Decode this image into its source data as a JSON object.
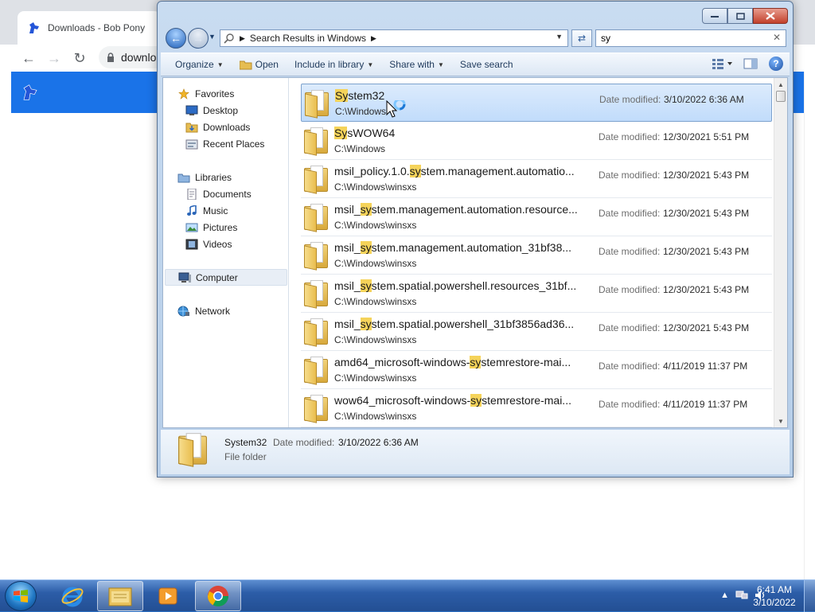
{
  "browser": {
    "tab_title": "Downloads - Bob Pony",
    "url_partial": "downlo",
    "icons": {
      "back": "arrow-left-icon",
      "forward": "arrow-right-icon",
      "reload": "reload-icon",
      "lock": "lock-icon",
      "favicon": "pony-icon"
    }
  },
  "explorer": {
    "address": "Search Results in Windows",
    "search_value": "sy",
    "toolbar": {
      "organize": "Organize",
      "open": "Open",
      "include_in_library": "Include in library",
      "share_with": "Share with",
      "save_search": "Save search"
    },
    "nav": {
      "favorites": "Favorites",
      "desktop": "Desktop",
      "downloads": "Downloads",
      "recent_places": "Recent Places",
      "libraries": "Libraries",
      "documents": "Documents",
      "music": "Music",
      "pictures": "Pictures",
      "videos": "Videos",
      "computer": "Computer",
      "network": "Network"
    },
    "date_label": "Date modified:",
    "results": [
      {
        "pre": "",
        "hl": "Sy",
        "post": "stem32",
        "path": "C:\\Windows",
        "date": "3/10/2022 6:36 AM",
        "selected": true
      },
      {
        "pre": "",
        "hl": "Sy",
        "post": "sWOW64",
        "path": "C:\\Windows",
        "date": "12/30/2021 5:51 PM"
      },
      {
        "pre": "msil_policy.1.0.",
        "hl": "sy",
        "post": "stem.management.automatio...",
        "path": "C:\\Windows\\winsxs",
        "date": "12/30/2021 5:43 PM"
      },
      {
        "pre": "msil_",
        "hl": "sy",
        "post": "stem.management.automation.resource...",
        "path": "C:\\Windows\\winsxs",
        "date": "12/30/2021 5:43 PM"
      },
      {
        "pre": "msil_",
        "hl": "sy",
        "post": "stem.management.automation_31bf38...",
        "path": "C:\\Windows\\winsxs",
        "date": "12/30/2021 5:43 PM"
      },
      {
        "pre": "msil_",
        "hl": "sy",
        "post": "stem.spatial.powershell.resources_31bf...",
        "path": "C:\\Windows\\winsxs",
        "date": "12/30/2021 5:43 PM"
      },
      {
        "pre": "msil_",
        "hl": "sy",
        "post": "stem.spatial.powershell_31bf3856ad36...",
        "path": "C:\\Windows\\winsxs",
        "date": "12/30/2021 5:43 PM"
      },
      {
        "pre": "amd64_microsoft-windows-",
        "hl": "sy",
        "post": "stemrestore-mai...",
        "path": "C:\\Windows\\winsxs",
        "date": "4/11/2019 11:37 PM"
      },
      {
        "pre": "wow64_microsoft-windows-",
        "hl": "sy",
        "post": "stemrestore-mai...",
        "path": "C:\\Windows\\winsxs",
        "date": "4/11/2019 11:37 PM"
      }
    ],
    "details": {
      "name": "System32",
      "date_label": "Date modified:",
      "date": "3/10/2022 6:36 AM",
      "type": "File folder"
    }
  },
  "taskbar": {
    "time": "6:41 AM",
    "date": "3/10/2022",
    "pinned": [
      "internet-explorer-icon",
      "windows-explorer-icon",
      "media-player-icon",
      "chrome-icon"
    ]
  },
  "colors": {
    "highlight": "#f5d35a",
    "selection": "#c1dcfb",
    "taskbar": "#2c5da8",
    "chrome_blue": "#1a73e8"
  }
}
